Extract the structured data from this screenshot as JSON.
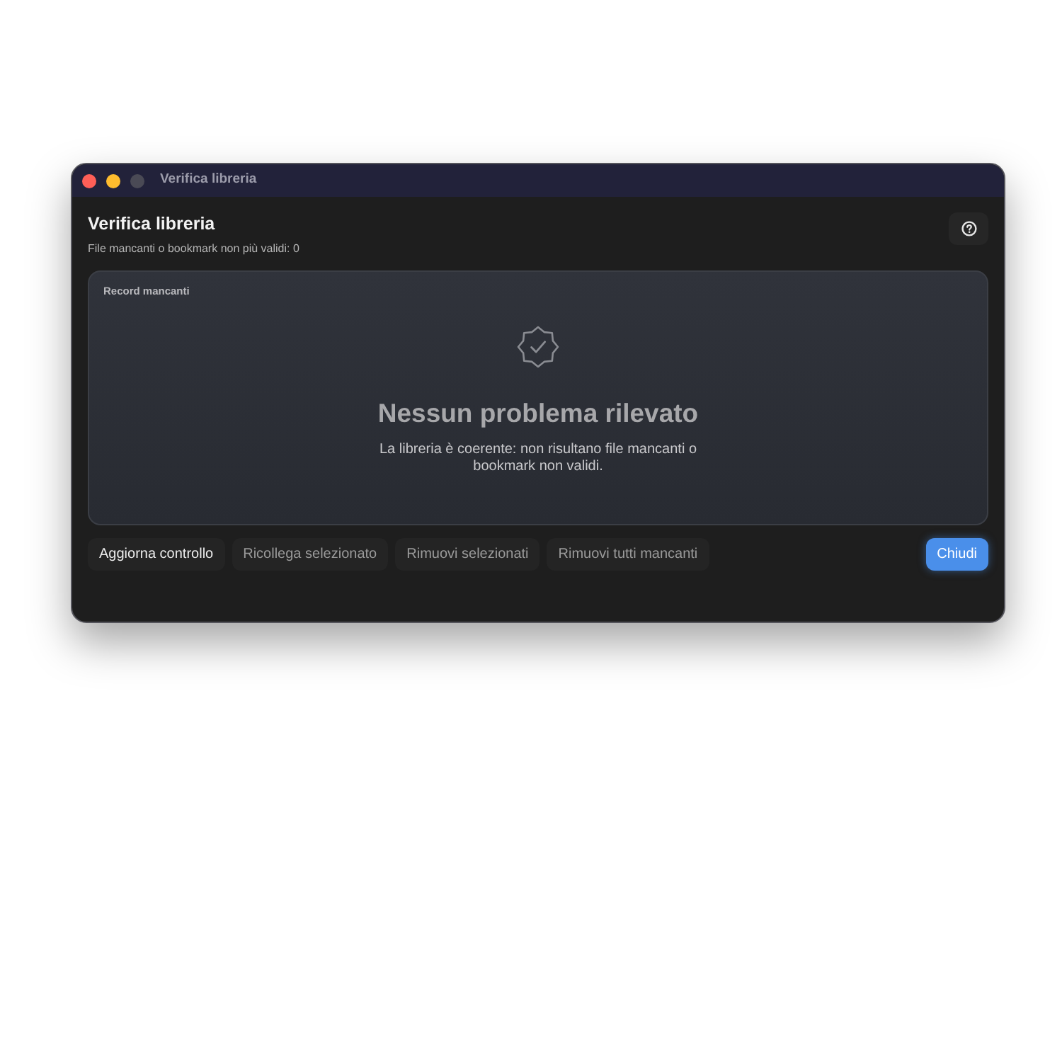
{
  "window": {
    "title": "Verifica libreria",
    "controls": [
      {
        "kind": "close",
        "disabled": false
      },
      {
        "kind": "minimize",
        "disabled": false
      },
      {
        "kind": "zoom",
        "disabled": true
      }
    ]
  },
  "header": {
    "title": "Verifica libreria",
    "subtitle": "File mancanti o bookmark non più validi: 0"
  },
  "panel": {
    "title": "Record mancanti",
    "empty_state": {
      "title": "Nessun problema rilevato",
      "message": "La libreria è coerente: non risultano file mancanti o bookmark non validi."
    }
  },
  "actions": [
    {
      "kind": "secondary",
      "label": "Aggiorna controllo",
      "disabled": false
    },
    {
      "kind": "secondary",
      "label": "Ricollega selezionato",
      "disabled": true
    },
    {
      "kind": "secondary",
      "label": "Rimuovi selezionati",
      "disabled": true
    },
    {
      "kind": "secondary",
      "label": "Rimuovi tutti mancanti",
      "disabled": true
    },
    {
      "kind": "primary",
      "label": "Chiudi",
      "disabled": false
    }
  ]
}
